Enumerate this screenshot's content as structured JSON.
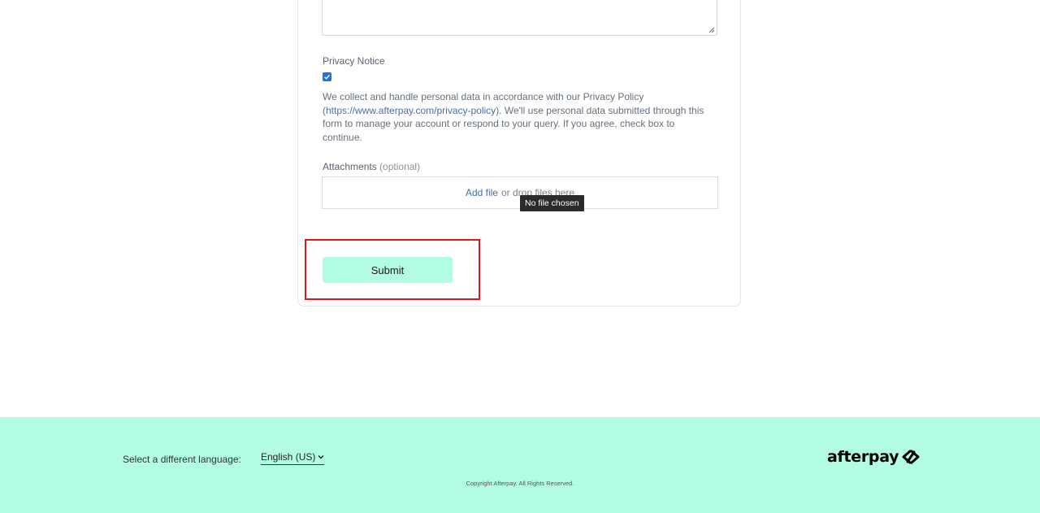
{
  "form": {
    "privacy": {
      "label": "Privacy Notice",
      "checked": true,
      "text_before_link": "We collect and handle personal data in accordance with our Privacy Policy (",
      "link_text": "https://www.afterpay.com/privacy-policy",
      "text_after_link": "). We'll use personal data submitted through this form to manage your account or respond to your query. If you agree, check box to continue."
    },
    "attachments": {
      "label": "Attachments",
      "optional": "(optional)",
      "add_file": "Add file",
      "drop_text": "or drop files here",
      "tooltip": "No file chosen"
    },
    "submit_label": "Submit"
  },
  "footer": {
    "language_label": "Select a different language:",
    "language_value": "English (US)",
    "copyright": "Copyright Afterpay. All Rights Reserved.",
    "logo_text": "afterpay"
  },
  "colors": {
    "accent": "#b2fce4",
    "highlight": "#e3141c",
    "checkbox": "#1a73e8",
    "link": "#4a6fa5"
  },
  "icons": {
    "checkbox": "check-icon",
    "resize": "resize-handle-icon",
    "dropdown": "chevron-down-icon",
    "logo": "afterpay-logo-icon"
  }
}
